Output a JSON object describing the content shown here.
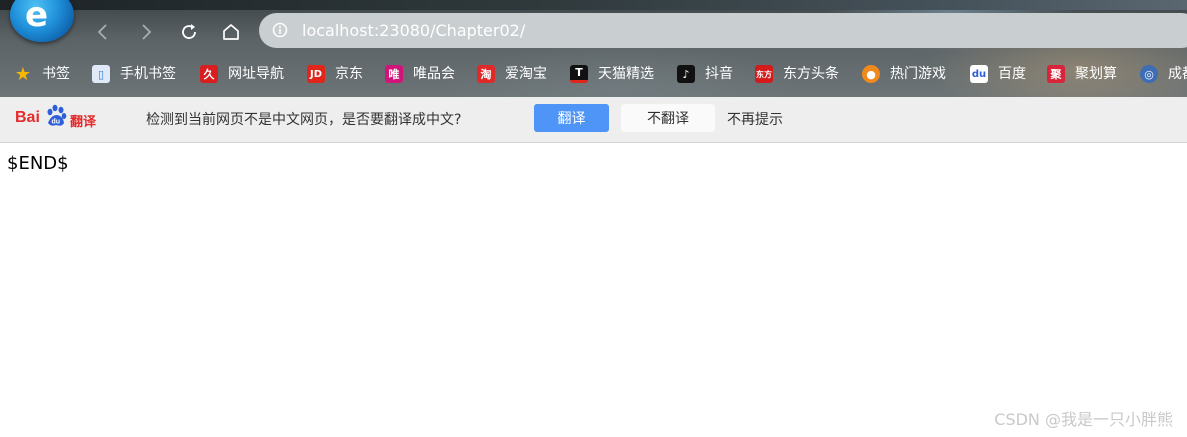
{
  "browser": {
    "address_url": "localhost:23080/Chapter02/"
  },
  "bookmarks": [
    {
      "label": "书签",
      "icon": "star-icon",
      "color": "#f5b800",
      "glyph": "★"
    },
    {
      "label": "手机书签",
      "icon": "phone-icon",
      "color": "#2f7fe0",
      "glyph": "▯"
    },
    {
      "label": "网址导航",
      "icon": "navigation-icon",
      "color": "#d81e1e",
      "glyph": "久"
    },
    {
      "label": "京东",
      "icon": "jd-icon",
      "color": "#e1251b",
      "glyph": "JD"
    },
    {
      "label": "唯品会",
      "icon": "vip-icon",
      "color": "#d1147a",
      "glyph": "唯"
    },
    {
      "label": "爱淘宝",
      "icon": "taobao-icon",
      "color": "#e02a2a",
      "glyph": "淘"
    },
    {
      "label": "天猫精选",
      "icon": "tmall-icon",
      "color": "#111111",
      "glyph": "T"
    },
    {
      "label": "抖音",
      "icon": "douyin-icon",
      "color": "#111111",
      "glyph": "♪"
    },
    {
      "label": "东方头条",
      "icon": "dftt-icon",
      "color": "#d41a1a",
      "glyph": "东方"
    },
    {
      "label": "热门游戏",
      "icon": "game-icon",
      "color": "#f08a1c",
      "glyph": "●"
    },
    {
      "label": "百度",
      "icon": "baidu-icon",
      "color": "#2f5fd8",
      "glyph": "du"
    },
    {
      "label": "聚划算",
      "icon": "juhuasuan-icon",
      "color": "#d8253b",
      "glyph": "聚"
    },
    {
      "label": "成都",
      "icon": "chengdu-icon",
      "color": "#3d6db5",
      "glyph": "◎"
    }
  ],
  "translate_bar": {
    "logo_text": "Bai",
    "logo_suffix": "翻译",
    "message": "检测到当前网页不是中文网页，是否要翻译成中文?",
    "translate_button": "翻译",
    "no_translate_button": "不翻译",
    "never_prompt": "不再提示"
  },
  "page": {
    "content_text": "$END$"
  },
  "watermark": "CSDN @我是一只小胖熊"
}
